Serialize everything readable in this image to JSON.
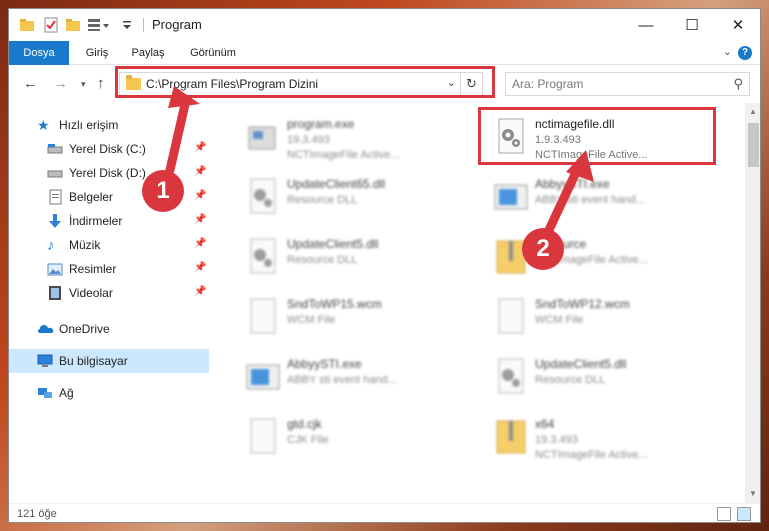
{
  "window": {
    "title": "Program",
    "controls": {
      "minimize": "—",
      "maximize": "☐",
      "close": "✕"
    }
  },
  "ribbon": {
    "tabs": [
      "Dosya",
      "Giriş",
      "Paylaş",
      "Görünüm"
    ],
    "help": "?"
  },
  "address": {
    "path": "C:\\Program Files\\Program Dizini",
    "search_placeholder": "Ara: Program"
  },
  "sidebar": {
    "quick_access": "Hızlı erişim",
    "items": [
      {
        "label": "Yerel Disk (C:)",
        "icon": "drive-icon",
        "pinned": true
      },
      {
        "label": "Yerel Disk (D:)",
        "icon": "drive-icon",
        "pinned": true
      },
      {
        "label": "Belgeler",
        "icon": "documents-icon",
        "pinned": true
      },
      {
        "label": "İndirmeler",
        "icon": "downloads-icon",
        "pinned": true
      },
      {
        "label": "Müzik",
        "icon": "music-icon",
        "pinned": true
      },
      {
        "label": "Resimler",
        "icon": "pictures-icon",
        "pinned": true
      },
      {
        "label": "Videolar",
        "icon": "videos-icon",
        "pinned": true
      }
    ],
    "onedrive": "OneDrive",
    "this_pc": "Bu bilgisayar",
    "network": "Ağ"
  },
  "files": [
    {
      "name": "program.exe",
      "meta1": "19.3.493",
      "meta2": "NCTImageFile Active...",
      "icon": "exe-icon"
    },
    {
      "name": "nctimagefile.dll",
      "meta1": "1.9.3.493",
      "meta2": "NCTImageFile Active...",
      "icon": "dll-gear-icon"
    },
    {
      "name": "UpdateClient65.dll",
      "meta1": "Resource DLL",
      "meta2": "",
      "icon": "dll-gear-icon"
    },
    {
      "name": "AbbyySTI.exe",
      "meta1": "ABBY sti event hand...",
      "meta2": "",
      "icon": "exe-window-icon"
    },
    {
      "name": "UpdateClient5.dll",
      "meta1": "Resource DLL",
      "meta2": "",
      "icon": "dll-gear-icon"
    },
    {
      "name": "Resource",
      "meta1": "NCTImageFile Active...",
      "meta2": "",
      "icon": "archive-icon"
    },
    {
      "name": "SndToWP15.wcm",
      "meta1": "WCM File",
      "meta2": "",
      "icon": "blank-file-icon"
    },
    {
      "name": "SndToWP12.wcm",
      "meta1": "WCM File",
      "meta2": "",
      "icon": "blank-file-icon"
    },
    {
      "name": "AbbyySTI.exe",
      "meta1": "ABBY sti event hand...",
      "meta2": "",
      "icon": "exe-window-icon"
    },
    {
      "name": "UpdateClient5.dll",
      "meta1": "Resource DLL",
      "meta2": "",
      "icon": "dll-gear-icon"
    },
    {
      "name": "gtd.cjk",
      "meta1": "CJK File",
      "meta2": "",
      "icon": "blank-file-icon"
    },
    {
      "name": "x64",
      "meta1": "19.3.493",
      "meta2": "NCTImageFile Active...",
      "icon": "archive-icon"
    }
  ],
  "status": {
    "count": "121 öğe"
  },
  "annotations": {
    "step1": "1",
    "step2": "2",
    "accent": "#d9363e"
  }
}
